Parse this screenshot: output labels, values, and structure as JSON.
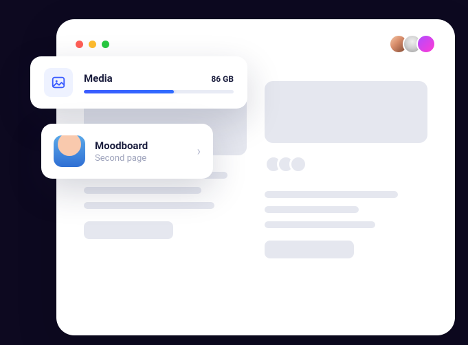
{
  "traffic_colors": {
    "red": "#ff5f57",
    "yellow": "#febc2e",
    "green": "#28c840"
  },
  "collaborators": [
    {
      "name": "user-1"
    },
    {
      "name": "user-2"
    },
    {
      "name": "user-3"
    }
  ],
  "media": {
    "label": "Media",
    "size": "86 GB",
    "progress_pct": 60
  },
  "moodboard": {
    "title": "Moodboard",
    "subtitle": "Second page"
  }
}
